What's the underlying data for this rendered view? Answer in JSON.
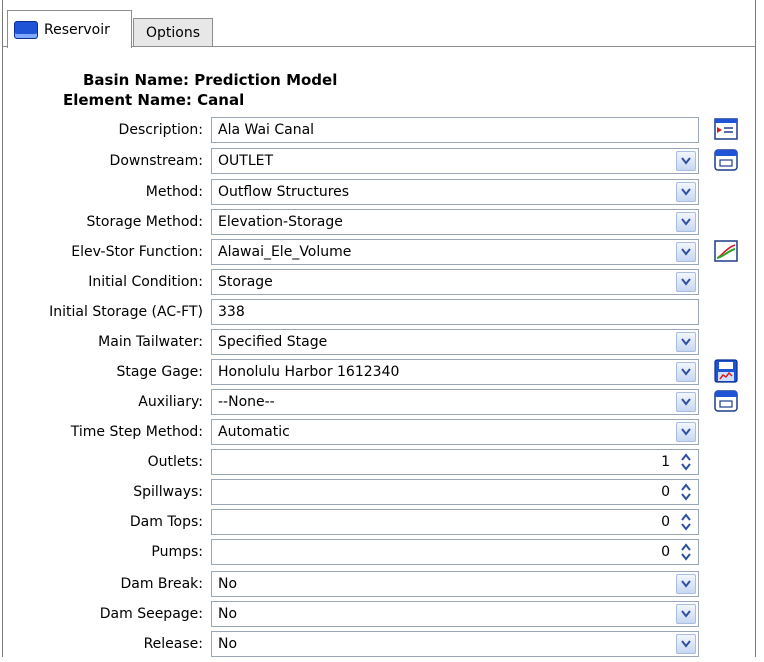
{
  "tabs": [
    {
      "label": "Reservoir",
      "active": true
    },
    {
      "label": "Options",
      "active": false
    }
  ],
  "header": {
    "basin": "Basin Name: Prediction Model",
    "element": "Element Name: Canal"
  },
  "fields": {
    "description": {
      "label": "Description:",
      "value": "Ala Wai Canal"
    },
    "downstream": {
      "label": "Downstream:",
      "value": "OUTLET"
    },
    "method": {
      "label": "Method:",
      "value": "Outflow Structures"
    },
    "storage_method": {
      "label": "Storage Method:",
      "value": "Elevation-Storage"
    },
    "elev_stor_function": {
      "label": "Elev-Stor Function:",
      "value": "Alawai_Ele_Volume"
    },
    "initial_condition": {
      "label": "Initial Condition:",
      "value": "Storage"
    },
    "initial_storage": {
      "label": "Initial Storage (AC-FT)",
      "value": "338"
    },
    "main_tailwater": {
      "label": "Main Tailwater:",
      "value": "Specified Stage"
    },
    "stage_gage": {
      "label": "Stage Gage:",
      "value": "Honolulu Harbor 1612340"
    },
    "auxiliary": {
      "label": "Auxiliary:",
      "value": "--None--"
    },
    "time_step_method": {
      "label": "Time Step Method:",
      "value": "Automatic"
    },
    "outlets": {
      "label": "Outlets:",
      "value": "1"
    },
    "spillways": {
      "label": "Spillways:",
      "value": "0"
    },
    "dam_tops": {
      "label": "Dam Tops:",
      "value": "0"
    },
    "pumps": {
      "label": "Pumps:",
      "value": "0"
    },
    "dam_break": {
      "label": "Dam Break:",
      "value": "No"
    },
    "dam_seepage": {
      "label": "Dam Seepage:",
      "value": "No"
    },
    "release": {
      "label": "Release:",
      "value": "No"
    }
  },
  "icons": {
    "description": "edit-description-icon",
    "downstream": "element-selector-icon",
    "elev_stor_function": "paired-data-chart-icon",
    "stage_gage": "time-series-gage-icon",
    "auxiliary": "element-selector-icon"
  },
  "colors": {
    "dropdown_arrow": "#2f4f9f",
    "icon_blue": "#1f54d6",
    "chart_line": "#2aa52a",
    "chart_red": "#d02020"
  }
}
